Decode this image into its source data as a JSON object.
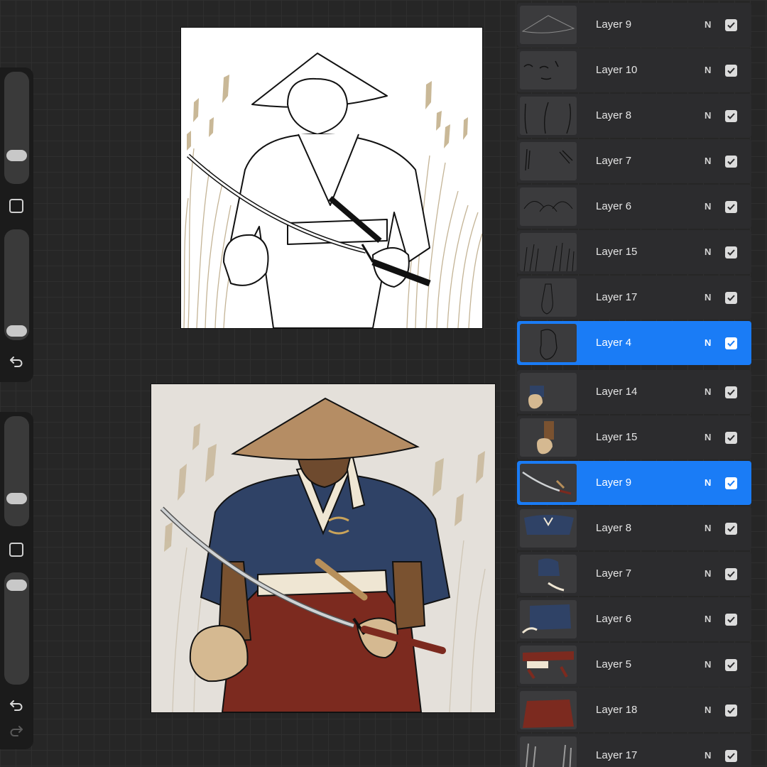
{
  "theme": {
    "background": "#262626",
    "panel": "#2c2c2e",
    "selected_accent": "#1a7cf6"
  },
  "sidebar": {
    "top_panel": [
      "brush-size-slider",
      "modify-button",
      "brush-opacity-slider",
      "undo-button"
    ],
    "bottom_panel": [
      "brush-size-slider",
      "modify-button",
      "brush-opacity-slider",
      "undo-button",
      "redo-button"
    ],
    "icons": {
      "undo": "undo-arrow-icon",
      "redo": "redo-arrow-icon",
      "modify": "square-outline-icon"
    }
  },
  "canvases": [
    {
      "id": "lineart",
      "description_colors": {
        "line": "#1a1a1a",
        "grass": "#b9a888",
        "paper": "#ffffff"
      }
    },
    {
      "id": "colored",
      "description_colors": {
        "hat": "#b58d64",
        "robe": "#2f4266",
        "hakama": "#7c2a1f",
        "skin": "#d5b991",
        "sky": "#e6e2dc"
      }
    }
  ],
  "layers": [
    {
      "name": "Layer 9",
      "blend": "N",
      "visible": true,
      "selected": false,
      "thumb": "hat-outline"
    },
    {
      "name": "Layer 10",
      "blend": "N",
      "visible": true,
      "selected": false,
      "thumb": "face-lines"
    },
    {
      "name": "Layer 8",
      "blend": "N",
      "visible": true,
      "selected": false,
      "thumb": "body-lines"
    },
    {
      "name": "Layer 7",
      "blend": "N",
      "visible": true,
      "selected": false,
      "thumb": "strokes"
    },
    {
      "name": "Layer 6",
      "blend": "N",
      "visible": true,
      "selected": false,
      "thumb": "sketch"
    },
    {
      "name": "Layer 15",
      "blend": "N",
      "visible": true,
      "selected": false,
      "thumb": "grass-lines"
    },
    {
      "name": "Layer 17",
      "blend": "N",
      "visible": true,
      "selected": false,
      "thumb": "arm-sketch"
    },
    {
      "name": "Layer 4",
      "blend": "N",
      "visible": true,
      "selected": true,
      "thumb": "fist-sketch"
    },
    {
      "name": "Layer 14",
      "blend": "N",
      "visible": true,
      "selected": false,
      "thumb": "hand-fill"
    },
    {
      "name": "Layer 15",
      "blend": "N",
      "visible": true,
      "selected": false,
      "thumb": "arm-fill"
    },
    {
      "name": "Layer 9",
      "blend": "N",
      "visible": true,
      "selected": true,
      "thumb": "katana"
    },
    {
      "name": "Layer 8",
      "blend": "N",
      "visible": true,
      "selected": false,
      "thumb": "robe-fill"
    },
    {
      "name": "Layer 7",
      "blend": "N",
      "visible": true,
      "selected": false,
      "thumb": "sleeve-fill"
    },
    {
      "name": "Layer 6",
      "blend": "N",
      "visible": true,
      "selected": false,
      "thumb": "cloth-fill"
    },
    {
      "name": "Layer 5",
      "blend": "N",
      "visible": true,
      "selected": false,
      "thumb": "sash-fill"
    },
    {
      "name": "Layer 18",
      "blend": "N",
      "visible": true,
      "selected": false,
      "thumb": "hakama-fill"
    },
    {
      "name": "Layer 17",
      "blend": "N",
      "visible": true,
      "selected": false,
      "thumb": "grass-fill"
    }
  ]
}
